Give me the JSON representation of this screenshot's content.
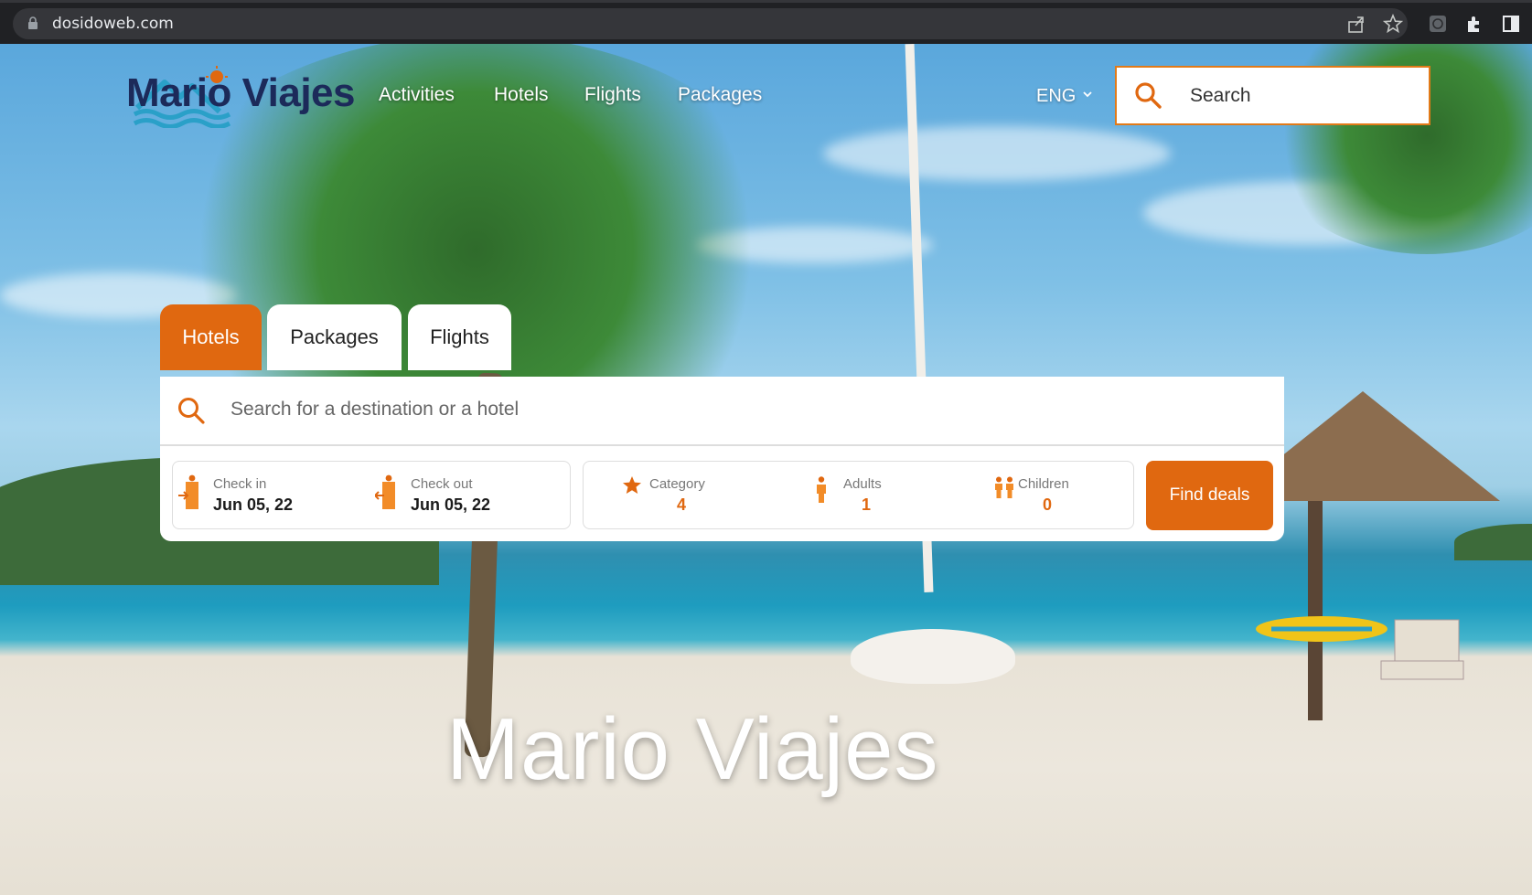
{
  "browser": {
    "url": "dosidoweb.com"
  },
  "header": {
    "logo_text": "Mario Viajes",
    "nav": [
      "Activities",
      "Hotels",
      "Flights",
      "Packages"
    ],
    "language": "ENG",
    "search_placeholder": "Search"
  },
  "tabs": [
    {
      "label": "Hotels",
      "active": true
    },
    {
      "label": "Packages",
      "active": false
    },
    {
      "label": "Flights",
      "active": false
    }
  ],
  "search": {
    "destination_placeholder": "Search for a destination or a hotel",
    "check_in": {
      "label": "Check in",
      "value": "Jun 05, 22"
    },
    "check_out": {
      "label": "Check out",
      "value": "Jun 05, 22"
    },
    "category": {
      "label": "Category",
      "value": "4"
    },
    "adults": {
      "label": "Adults",
      "value": "1"
    },
    "children": {
      "label": "Children",
      "value": "0"
    },
    "button": "Find deals"
  },
  "hero_title": "Mario Viajes",
  "colors": {
    "accent": "#e06810",
    "logo_navy": "#1c2a5a",
    "logo_teal": "#2aa0c8"
  }
}
